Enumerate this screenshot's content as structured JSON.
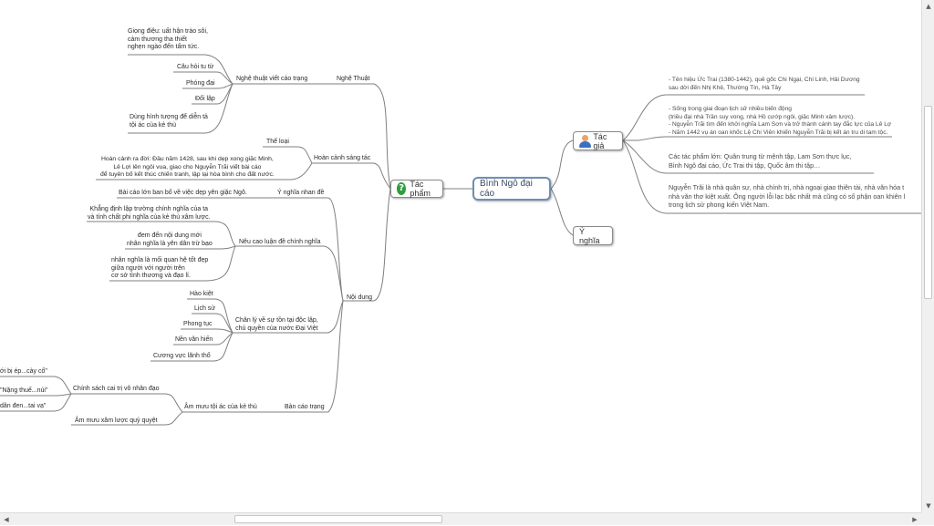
{
  "central": "Bình Ngô đại cáo",
  "tac_pham": {
    "label": "Tác phẩm",
    "icon": "question-icon",
    "nghe_thuat": {
      "label": "Nghệ Thuật",
      "sub": "Nghệ thuật viết cáo trạng",
      "items": [
        "Giọng điệu: uất hận trào sôi,\ncảm thương tha thiết\nnghẹn ngào đến tấm tức.",
        "Câu hỏi tu từ",
        "Phóng đại",
        "Đối lập",
        "Dùng hình tượng để diễn tả\ntội ác của kẻ thù"
      ]
    },
    "hoan_canh": {
      "label": "Hoàn cảnh sáng tác",
      "the_loai": "Thể loại",
      "text": "Hoàn cảnh ra đời: Đầu năm 1428, sau khi dẹp xong giặc Minh,\nLê Lợi lên ngôi vua, giao cho Nguyễn Trãi viết bài cáo\nđể tuyên bố kết thúc chiến tranh, lập lại hòa bình cho đất nước."
    },
    "noi_dung": {
      "label": "Nội dung",
      "y_nghia_nhan_de": {
        "label": "Ý nghĩa nhan đề",
        "text": "Bài cáo lớn ban bố về việc dẹp yên giặc Ngô."
      },
      "nhan_nghia": {
        "label": "Nêu cao luận đề chính nghĩa",
        "items": [
          "Khẳng định lập trường chính nghĩa của ta\nvà tính chất phi nghĩa của kẻ thù xâm lược.",
          "đem đến nội dung mới\nnhân nghĩa là yên dân trừ bạo",
          "nhân nghĩa là mối quan hệ tốt đẹp\ngiữa người với người trên\ncơ sở tình thương và đạo lí."
        ]
      },
      "chan_ly": {
        "label": "Chân lý về sự tồn tại độc lập,\nchủ quyền của nước Đại Việt",
        "items": [
          "Hào kiệt",
          "Lịch sử",
          "Phong tục",
          "Nền văn hiến",
          "Cương vực lãnh thổ"
        ]
      },
      "ban_cao_trang": {
        "label": "Bản cáo trạng",
        "am_muu": "Âm mưu tội ác của kẻ thù",
        "chinh_sach": "Chính sách cai trị vô nhân đạo",
        "chinh_sach_items": [
          "ới bị ép...cày cố\"",
          "\"Nặng thuế...núi\"",
          "dân đen...tai vạ\""
        ],
        "am_muu_xam_luoc": "Âm mưu xâm lược quỷ quyệt"
      }
    }
  },
  "tac_gia": {
    "label": "Tác giả",
    "icon": "person-icon",
    "notes": [
      "- Tên hiệu Ức Trai (1380-1442), quê gốc Chi Ngại, Chí Linh, Hải Dương\nsau dời đến Nhị Khê, Thường Tín, Hà Tây",
      "- Sống trong giai đoạn lịch sử nhiều biến động\n(triều đại nhà Trần suy vong, nhà Hồ cướp ngôi, giặc Minh xâm lược).\n- Nguyễn Trãi tìm đến khởi nghĩa Lam Sơn và trở thành cánh tay đắc lực của Lê Lợ\n- Năm 1442 vụ án oan khốc Lệ Chi Viên khiến Nguyễn Trãi bị kết án tru di tam tộc.",
      "Các tác phẩm lớn: Quân trung từ mệnh tập, Lam Sơn thực lục,\nBình Ngô đại cáo, Ức Trai thi tập, Quốc âm thi tập…",
      "Nguyễn Trãi là nhà quân sự, nhà chính trị, nhà ngoại giao thiên tài, nhà văn hóa t\nnhà văn thơ kiệt xuất. Ông người lỗi lạc bậc nhất mà cũng có số phận oan khiên l\ntrong lịch sử phong kiến Việt Nam."
    ]
  },
  "y_nghia": {
    "label": "Ý nghĩa"
  },
  "colors": {
    "line": "#7f7f7f",
    "central_border": "#6f8fb3",
    "node_border": "#8a8a8a"
  }
}
